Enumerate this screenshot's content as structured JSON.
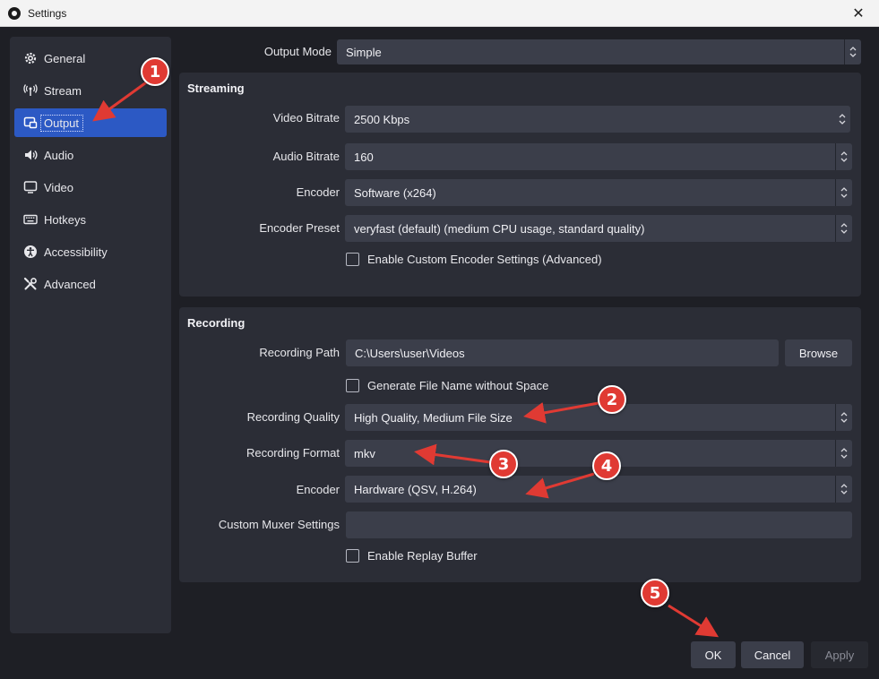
{
  "window": {
    "title": "Settings",
    "close_label": "✕"
  },
  "sidebar": {
    "items": [
      {
        "label": "General",
        "icon": "gear-icon"
      },
      {
        "label": "Stream",
        "icon": "antenna-icon"
      },
      {
        "label": "Output",
        "icon": "output-icon",
        "active": true
      },
      {
        "label": "Audio",
        "icon": "speaker-icon"
      },
      {
        "label": "Video",
        "icon": "monitor-icon"
      },
      {
        "label": "Hotkeys",
        "icon": "keyboard-icon"
      },
      {
        "label": "Accessibility",
        "icon": "accessibility-icon"
      },
      {
        "label": "Advanced",
        "icon": "tools-icon"
      }
    ]
  },
  "output_mode": {
    "label": "Output Mode",
    "value": "Simple"
  },
  "streaming": {
    "title": "Streaming",
    "video_bitrate": {
      "label": "Video Bitrate",
      "value": "2500 Kbps"
    },
    "audio_bitrate": {
      "label": "Audio Bitrate",
      "value": "160"
    },
    "encoder": {
      "label": "Encoder",
      "value": "Software (x264)"
    },
    "encoder_preset": {
      "label": "Encoder Preset",
      "value": "veryfast (default) (medium CPU usage, standard quality)"
    },
    "custom_encoder": {
      "label": "Enable Custom Encoder Settings (Advanced)",
      "checked": false
    }
  },
  "recording": {
    "title": "Recording",
    "path": {
      "label": "Recording Path",
      "value": "C:\\Users\\user\\Videos",
      "browse_label": "Browse"
    },
    "no_space": {
      "label": "Generate File Name without Space",
      "checked": false
    },
    "quality": {
      "label": "Recording Quality",
      "value": "High Quality, Medium File Size"
    },
    "format": {
      "label": "Recording Format",
      "value": "mkv"
    },
    "encoder": {
      "label": "Encoder",
      "value": "Hardware (QSV, H.264)"
    },
    "muxer": {
      "label": "Custom Muxer Settings",
      "value": ""
    },
    "replay_buffer": {
      "label": "Enable Replay Buffer",
      "checked": false
    }
  },
  "footer": {
    "ok_label": "OK",
    "cancel_label": "Cancel",
    "apply_label": "Apply"
  },
  "annotations": {
    "color": "#e03a33",
    "badges": [
      "1",
      "2",
      "3",
      "4",
      "5"
    ]
  },
  "colors": {
    "accent": "#2c59c4",
    "panel": "#2b2d36",
    "field": "#3b3e4a",
    "background": "#1e1f25"
  }
}
